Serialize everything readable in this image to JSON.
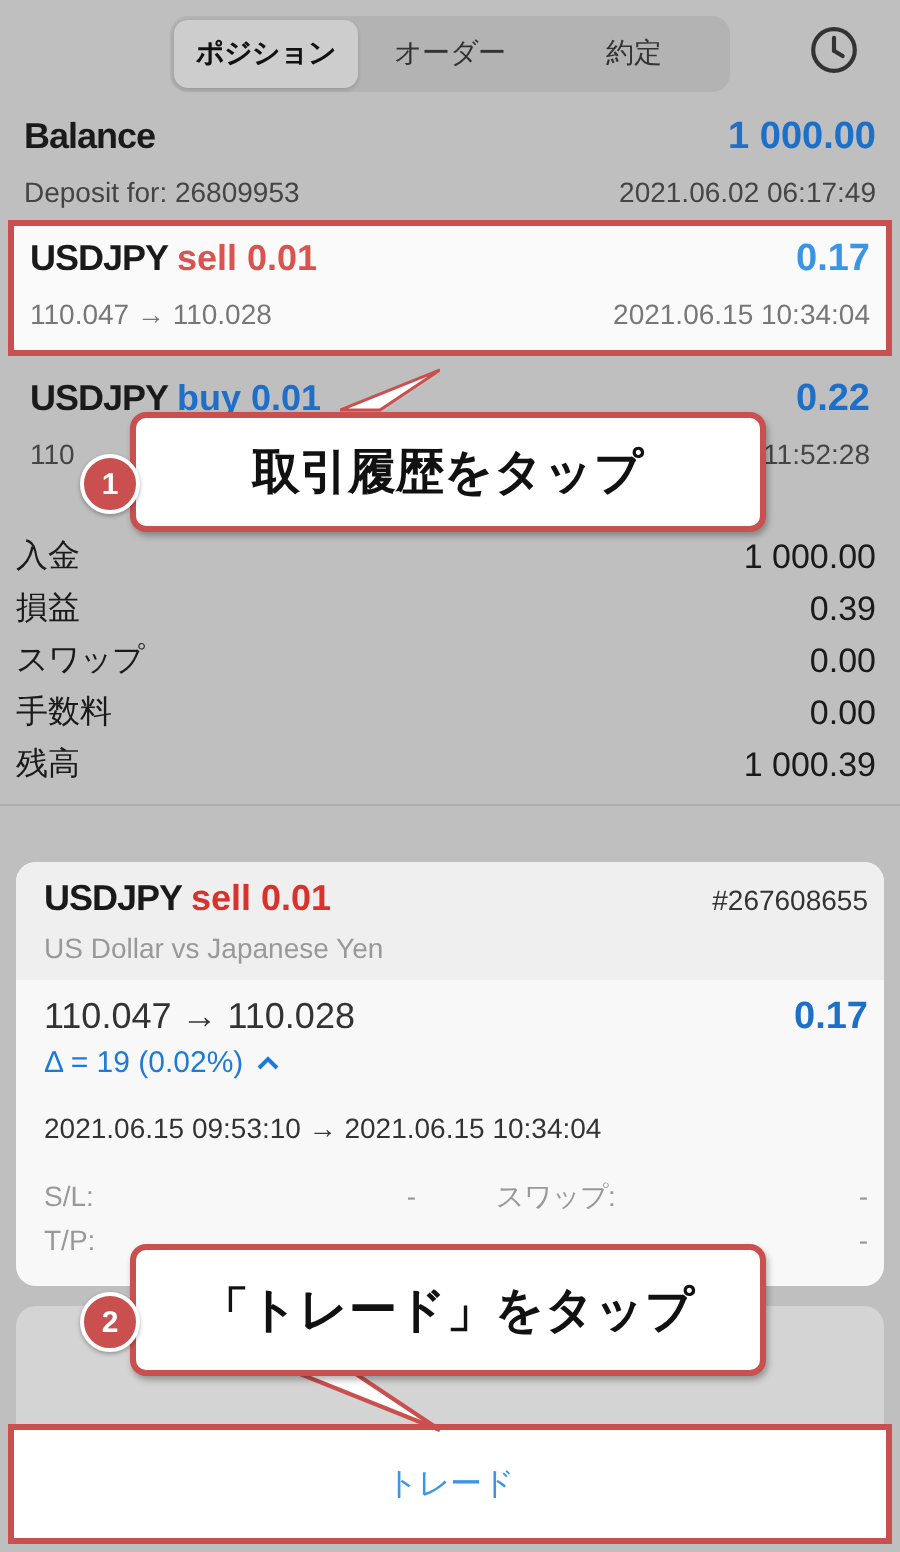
{
  "tabs": [
    {
      "label": "ポジション",
      "selected": true
    },
    {
      "label": "オーダー",
      "selected": false
    },
    {
      "label": "約定",
      "selected": false
    }
  ],
  "balance": {
    "title": "Balance",
    "amount": "1 000.00",
    "subtitle": "Deposit for: 26809953",
    "time": "2021.06.02 06:17:49"
  },
  "deals": [
    {
      "symbol": "USDJPY",
      "side": "sell 0.01",
      "color": "#d9534f",
      "profit": "0.17",
      "prices": "110.047 → 110.028",
      "time": "2021.06.15 10:34:04",
      "highlighted": true
    },
    {
      "symbol": "USDJPY",
      "side": "buy 0.01",
      "color": "#1e6fc8",
      "profit": "0.22",
      "prices": "110",
      "time": "11:52:28",
      "highlighted": false
    }
  ],
  "summary": [
    {
      "label": "入金",
      "value": "1 000.00"
    },
    {
      "label": "損益",
      "value": "0.39"
    },
    {
      "label": "スワップ",
      "value": "0.00"
    },
    {
      "label": "手数料",
      "value": "0.00"
    },
    {
      "label": "残高",
      "value": "1 000.39"
    }
  ],
  "detail": {
    "symbol": "USDJPY",
    "side": "sell 0.01",
    "color": "#d8322a",
    "ticket": "#267608655",
    "description": "US Dollar vs Japanese Yen",
    "prices": "110.047 → 110.028",
    "profit": "0.17",
    "delta": "Δ = 19 (0.02%)",
    "expanded": true,
    "times": "2021.06.15 09:53:10 → 2021.06.15 10:34:04",
    "fields": [
      {
        "label": "S/L:",
        "value": "-"
      },
      {
        "label": "スワップ:",
        "value": "-"
      },
      {
        "label": "T/P:"
      },
      {
        "value": "-"
      }
    ]
  },
  "trade_button": {
    "label": "トレード",
    "highlighted": true
  },
  "callouts": [
    {
      "number": "1",
      "text": "取引履歴をタップ"
    },
    {
      "number": "2",
      "text": "「トレード」をタップ"
    }
  ]
}
